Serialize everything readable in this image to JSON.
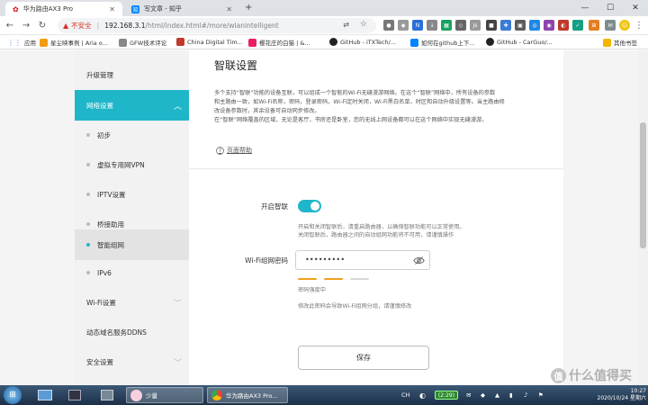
{
  "browser": {
    "tabs": [
      {
        "title": "华为路由AX3 Pro",
        "active": true
      },
      {
        "title": "写文章 - 知乎",
        "active": false
      }
    ],
    "new_tab_icon": "plus-icon",
    "window_controls": [
      "minimize-icon",
      "maximize-icon",
      "close-icon"
    ],
    "address": {
      "security_label": "不安全",
      "host": "192.168.3.1",
      "path": "/html/index.html#/more/wlanintelligent"
    },
    "bookmarks": [
      {
        "label": "应用"
      },
      {
        "label": "星尘映事例 | Aria o..."
      },
      {
        "label": "GFW技术评论"
      },
      {
        "label": "China Digital Tim..."
      },
      {
        "label": "樱花庄的白猫 | &..."
      },
      {
        "label": "GitHub - iTXTech/..."
      },
      {
        "label": "如何在github上下..."
      },
      {
        "label": "GitHub - CarGuo/..."
      }
    ],
    "other_bookmarks": "其他书签"
  },
  "sidebar": {
    "items": [
      {
        "label": "升级管理"
      },
      {
        "label": "网络设置"
      },
      {
        "label": "初步"
      },
      {
        "label": "虚拟专用网VPN"
      },
      {
        "label": "IPTV设置"
      },
      {
        "label": "桥接助用"
      },
      {
        "label": "智能组网"
      },
      {
        "label": "IPv6"
      },
      {
        "label": "Wi-Fi设置"
      },
      {
        "label": "动态域名服务DDNS"
      },
      {
        "label": "安全设置"
      }
    ]
  },
  "main": {
    "title": "智联设置",
    "description_lines": [
      "多个支持“智联”功能的设备互联，可以组成一个智能的Wi-Fi无缝漫游网络。在这个“智联”网络中，所有设备的参数",
      "和主路由一致，如Wi-Fi名称，密码，登录密码，Wi-Fi定时关闭，Wi-Fi黑白名单，时区和自动升级设置等。当主路由修",
      "改设备参数时，其余设备可自动同步修改。",
      "在“智联”网络覆盖的区域，无论是客厅，书房还是卧室，您的无线上网设备都可以在这个网络中实现无缝漫游。"
    ],
    "help_link": "页面帮助",
    "enable_label": "开启智联",
    "enable_state": "on",
    "enable_hint_lines": [
      "开启和关闭智联后，请重启路由器，以确保智联功能可以正常使用。",
      "关闭智联后，路由器之间的自动组网功能将不可用，请谨慎操作"
    ],
    "password_label": "Wi-Fi组网密码",
    "password_value": "•••••••••",
    "password_strength": {
      "bars": 3,
      "filled": 2,
      "color": "#f0a020",
      "text": "密码强度中"
    },
    "password_hint": "修改此密码会导致Wi-Fi组网分组，请谨慎修改",
    "save_label": "保存"
  },
  "taskbar": {
    "items": [
      {
        "label": "少量"
      },
      {
        "label": "华为路由AX3 Pro..."
      }
    ],
    "tray": {
      "ime": "CH",
      "battery": "(2:29)"
    },
    "clock_time": "10:27",
    "clock_date": "2020/10/24 星期六"
  },
  "watermark": "什么值得买",
  "colors": {
    "accent": "#1fb6c9",
    "warning": "#d93025",
    "strength": "#f0a020"
  }
}
